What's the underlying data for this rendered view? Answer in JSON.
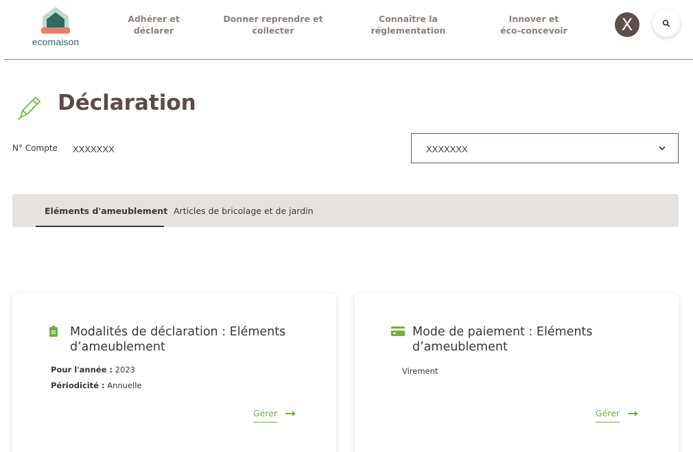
{
  "header": {
    "logo_text": "ecomaison",
    "nav": [
      {
        "line1": "Adhérer et",
        "line2": "déclarer"
      },
      {
        "line1": "Donner reprendre et",
        "line2": "collecter"
      },
      {
        "line1": "Connaître la",
        "line2": "réglementation"
      },
      {
        "line1": "Innover et",
        "line2": "éco-concevoir"
      }
    ],
    "avatar_letter": "X",
    "search_icon": "search-icon"
  },
  "page": {
    "title": "Déclaration",
    "title_icon": "pencil-icon"
  },
  "account": {
    "label": "N° Compte",
    "value": "XXXXXXX",
    "select_value": "XXXXXXX"
  },
  "tabs": [
    {
      "label": "Eléments d'ameublement",
      "active": true
    },
    {
      "label": "Articles de bricolage et de jardin",
      "active": false
    }
  ],
  "cards": [
    {
      "icon": "clipboard-icon",
      "title": "Modalités de déclaration : Eléments d’ameublement",
      "year_label": "Pour l'année :",
      "year_value": "2023",
      "period_label": "Périodicité :",
      "period_value": "Annuelle",
      "action_label": "Gérer"
    },
    {
      "icon": "credit-card-icon",
      "title": "Mode de paiement : Eléments d’ameublement",
      "payment_value": "Virement",
      "action_label": "Gérer"
    }
  ],
  "colors": {
    "brand_green": "#6fb03b",
    "brand_dark": "#5b4c47",
    "tab_bar": "#e6e2df",
    "logo_teal": "#2e6b5f",
    "logo_coral": "#ef7c6a"
  }
}
